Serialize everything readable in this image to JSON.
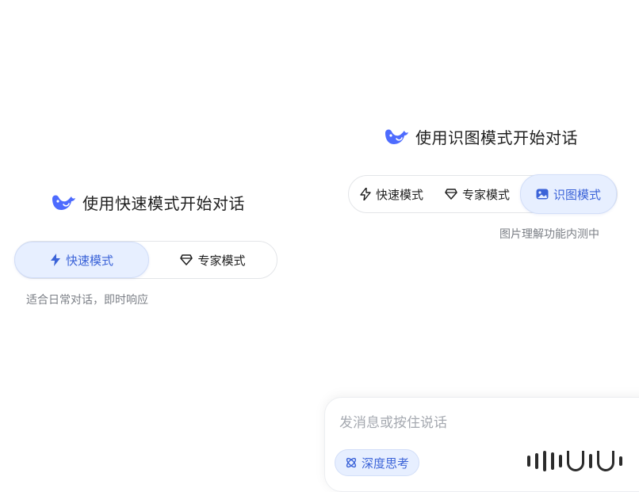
{
  "left_panel": {
    "title": "使用快速模式开始对话",
    "modes": [
      {
        "label": "快速模式",
        "icon": "lightning-icon",
        "active": true
      },
      {
        "label": "专家模式",
        "icon": "diamond-icon",
        "active": false
      }
    ],
    "caption": "适合日常对话，即时响应"
  },
  "right_panel": {
    "title": "使用识图模式开始对话",
    "modes": [
      {
        "label": "快速模式",
        "icon": "lightning-icon",
        "active": false
      },
      {
        "label": "专家模式",
        "icon": "diamond-icon",
        "active": false
      },
      {
        "label": "识图模式",
        "icon": "image-icon",
        "active": true
      }
    ],
    "caption": "图片理解功能内测中"
  },
  "input": {
    "placeholder": "发消息或按住说话",
    "deep_think_label": "深度思考"
  },
  "colors": {
    "accent": "#3b63d8",
    "active_bg": "#e7efff",
    "caption": "#7b7f86",
    "logo": "#4d6bfe"
  }
}
